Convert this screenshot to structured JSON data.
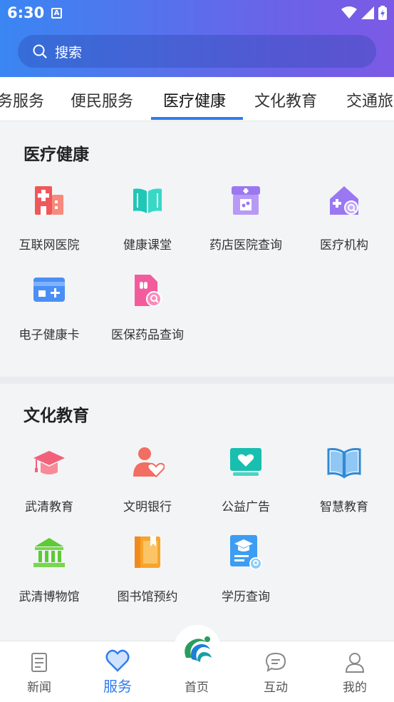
{
  "status_bar": {
    "time": "6:30",
    "notif_glyph": "A"
  },
  "search": {
    "placeholder": "搜索"
  },
  "tabs": [
    "务服务",
    "便民服务",
    "医疗健康",
    "文化教育",
    "交通旅"
  ],
  "active_tab": "医疗健康",
  "sections": [
    {
      "title": "医疗健康",
      "items": [
        {
          "label": "互联网医院",
          "icon": "hospital-icon"
        },
        {
          "label": "健康课堂",
          "icon": "open-book-icon"
        },
        {
          "label": "药店医院查询",
          "icon": "pharmacy-icon"
        },
        {
          "label": "医疗机构",
          "icon": "medical-house-search-icon"
        },
        {
          "label": "电子健康卡",
          "icon": "health-card-icon"
        },
        {
          "label": "医保药品查询",
          "icon": "medicine-search-icon"
        }
      ]
    },
    {
      "title": "文化教育",
      "items": [
        {
          "label": "武清教育",
          "icon": "graduation-cap-icon"
        },
        {
          "label": "文明银行",
          "icon": "person-heart-icon"
        },
        {
          "label": "公益广告",
          "icon": "charity-screen-icon"
        },
        {
          "label": "智慧教育",
          "icon": "book-icon"
        },
        {
          "label": "武清博物馆",
          "icon": "museum-icon"
        },
        {
          "label": "图书馆预约",
          "icon": "library-book-icon"
        },
        {
          "label": "学历查询",
          "icon": "diploma-search-icon"
        }
      ]
    }
  ],
  "bottom_nav": [
    {
      "label": "新闻",
      "icon": "news-icon"
    },
    {
      "label": "服务",
      "icon": "heart-icon"
    },
    {
      "label": "首页",
      "icon": "home-logo-icon"
    },
    {
      "label": "互动",
      "icon": "chat-icon"
    },
    {
      "label": "我的",
      "icon": "user-icon"
    }
  ],
  "active_nav": "服务",
  "colors": {
    "accent": "#2f7cf0",
    "header_start": "#3a86f2",
    "header_end": "#7c5ae6"
  }
}
